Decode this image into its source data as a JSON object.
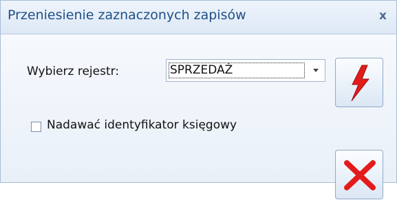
{
  "dialog": {
    "title": "Przeniesienie zaznaczonych zapisów",
    "close_glyph": "x",
    "register_label": "Wybierz rejestr:",
    "register_value": "SPRZEDAŻ",
    "checkbox_label": "Nadawać identyfikator księgowy",
    "checkbox_checked": false,
    "icons": {
      "ok": "lightning-icon",
      "cancel": "red-x-icon",
      "dropdown": "chevron-down-icon"
    },
    "colors": {
      "ok_icon": "#e31b1b",
      "cancel_icon": "#e31b1b"
    }
  }
}
